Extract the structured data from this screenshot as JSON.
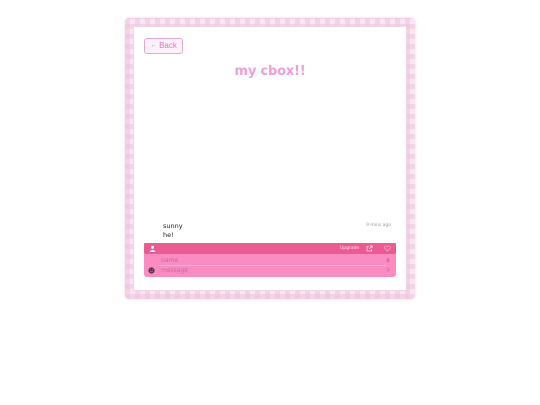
{
  "header": {
    "back_label": "Back",
    "title": "my cbox!!"
  },
  "messages": [
    {
      "author": "sunny",
      "text": "he!",
      "time": "9 mins ago"
    }
  ],
  "toolbar": {
    "upgrade_label": "Upgrade",
    "icons": [
      "user-icon",
      "external-link-icon",
      "heart-icon"
    ]
  },
  "form": {
    "name_placeholder": "name",
    "message_placeholder": "message",
    "icons": [
      "emoji-icon",
      "bell-icon",
      "send-icon"
    ]
  },
  "colors": {
    "title": "#ef9ed6",
    "bar": "#ec5a92",
    "form": "#fa8cc2",
    "frame": "#f9e6f1"
  }
}
